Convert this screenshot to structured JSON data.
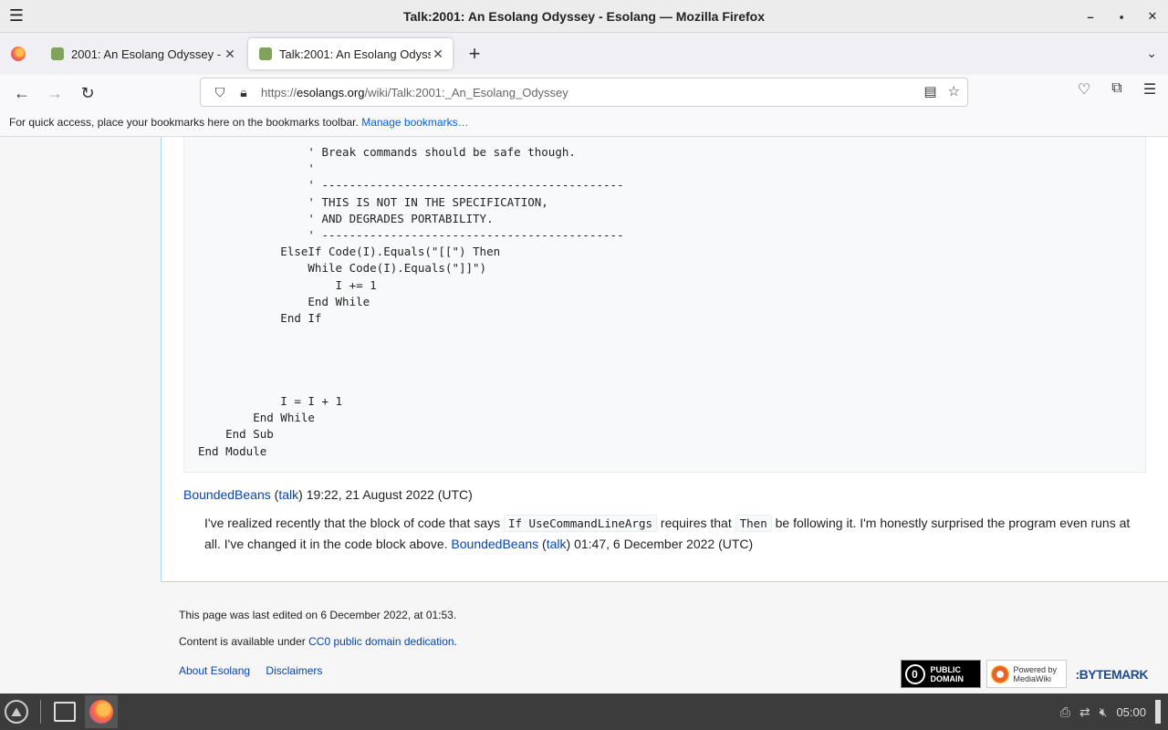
{
  "window": {
    "title": "Talk:2001: An Esolang Odyssey - Esolang — Mozilla Firefox",
    "controls": [
      "–",
      "▪",
      "✕"
    ]
  },
  "tabs": [
    {
      "label": "2001: An Esolang Odyssey - Esolang",
      "active": false
    },
    {
      "label": "Talk:2001: An Esolang Odyssey - Esolang",
      "active": true
    }
  ],
  "navbar": {
    "url_prefix": "https://",
    "url_host": "esolangs.org",
    "url_path": "/wiki/Talk:2001:_An_Esolang_Odyssey"
  },
  "bookmarks": {
    "hint": "For quick access, place your bookmarks here on the bookmarks toolbar.",
    "manage_link": "Manage bookmarks…"
  },
  "code_block": "                ' Break commands should be safe though.\n                '\n                ' --------------------------------------------\n                ' THIS IS NOT IN THE SPECIFICATION,\n                ' AND DEGRADES PORTABILITY.\n                ' --------------------------------------------\n            ElseIf Code(I).Equals(\"[[\") Then\n                While Code(I).Equals(\"]]\")\n                    I += 1\n                End While\n            End If\n\n\n\n\n            I = I + 1\n        End While\n    End Sub\nEnd Module",
  "signature": {
    "user": "BoundedBeans",
    "talk": "talk",
    "timestamp": "19:22, 21 August 2022 (UTC)"
  },
  "reply": {
    "text_1": "I've realized recently that the block of code that says",
    "code_1": "If UseCommandLineArgs",
    "text_2": "requires that",
    "code_2": "Then",
    "text_3": "be following it. I'm honestly surprised the program even runs at all. I've changed it in the code block above.",
    "user": "BoundedBeans",
    "talk": "talk",
    "timestamp": "01:47, 6 December 2022 (UTC)"
  },
  "footer": {
    "last_edited": "This page was last edited on 6 December 2022, at 01:53.",
    "license_prefix": "Content is available under",
    "license_link": "CC0 public domain dedication",
    "license_suffix": ".",
    "about": "About Esolang",
    "disclaimers": "Disclaimers",
    "badge_pd_line1": "PUBLIC",
    "badge_pd_line2": "DOMAIN",
    "badge_mw_line1": "Powered by",
    "badge_mw_line2": "MediaWiki",
    "badge_bm": ":BYTEMARK"
  },
  "taskbar": {
    "clock": "05:00"
  },
  "colors": {
    "link": "#0645ad",
    "content_border": "#a7d7f9",
    "taskbar": "#3c3c3c"
  }
}
